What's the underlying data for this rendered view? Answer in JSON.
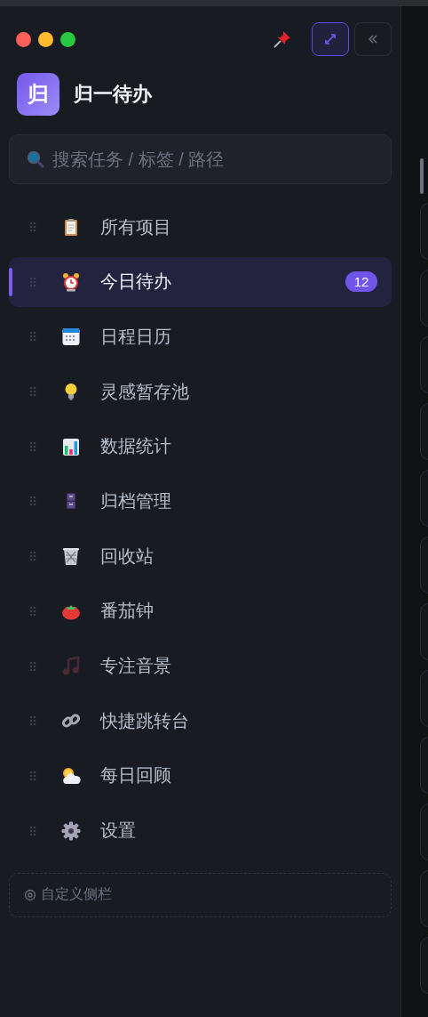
{
  "app": {
    "title": "归一待办",
    "logo_letter": "归"
  },
  "search": {
    "placeholder": "搜索任务 / 标签 / 路径"
  },
  "nav": [
    {
      "label": "所有项目",
      "selected": false
    },
    {
      "label": "今日待办",
      "selected": true,
      "badge": "12"
    },
    {
      "label": "日程日历",
      "selected": false
    },
    {
      "label": "灵感暂存池",
      "selected": false
    },
    {
      "label": "数据统计",
      "selected": false
    },
    {
      "label": "归档管理",
      "selected": false
    },
    {
      "label": "回收站",
      "selected": false
    },
    {
      "label": "番茄钟",
      "selected": false
    },
    {
      "label": "专注音景",
      "selected": false
    },
    {
      "label": "快捷跳转台",
      "selected": false
    },
    {
      "label": "每日回顾",
      "selected": false
    },
    {
      "label": "设置",
      "selected": false
    }
  ],
  "customize_button": {
    "label": "自定义侧栏"
  }
}
